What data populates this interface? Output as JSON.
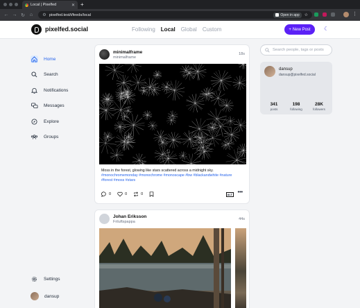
{
  "browser": {
    "tab_title": "Local | Pixelfed",
    "url": "pixelfed.test/i/feeds/local",
    "open_in_app": "Open in app"
  },
  "header": {
    "brand": "pixelfed.social",
    "feeds": [
      {
        "label": "Following"
      },
      {
        "label": "Local"
      },
      {
        "label": "Global"
      },
      {
        "label": "Custom"
      }
    ],
    "new_post": "New Post"
  },
  "sidebar": {
    "items": [
      {
        "label": "Home",
        "icon": "home-icon"
      },
      {
        "label": "Search",
        "icon": "search-icon"
      },
      {
        "label": "Notifications",
        "icon": "bell-icon"
      },
      {
        "label": "Messages",
        "icon": "chat-icon"
      },
      {
        "label": "Explore",
        "icon": "compass-icon"
      },
      {
        "label": "Groups",
        "icon": "users-icon"
      }
    ],
    "settings": "Settings",
    "user": "dansup"
  },
  "posts": [
    {
      "name": "minimalframe",
      "handle": "minimalframe",
      "time": "18s",
      "caption": "Moss in the forest, glowing like stars scattered across a midnight sky.",
      "tags": "#monochromemonday #monochrome #monoscape #bw #blackandwhite #nature #forest #moss #stars",
      "likes": "0",
      "comments": "0",
      "shares": "0",
      "alt": "ALT"
    },
    {
      "name": "Johan Eriksson",
      "handle": "Friluftspappa",
      "time": "44s"
    }
  ],
  "right": {
    "search_placeholder": "Search people, tags or posts",
    "profile": {
      "name": "dansup",
      "handle": "dansup@pixelfed.social",
      "stats": [
        {
          "value": "341",
          "label": "posts"
        },
        {
          "value": "198",
          "label": "following"
        },
        {
          "value": "28K",
          "label": "followers"
        }
      ]
    }
  },
  "colors": {
    "accent": "#5b21f6",
    "link": "#2563eb"
  }
}
